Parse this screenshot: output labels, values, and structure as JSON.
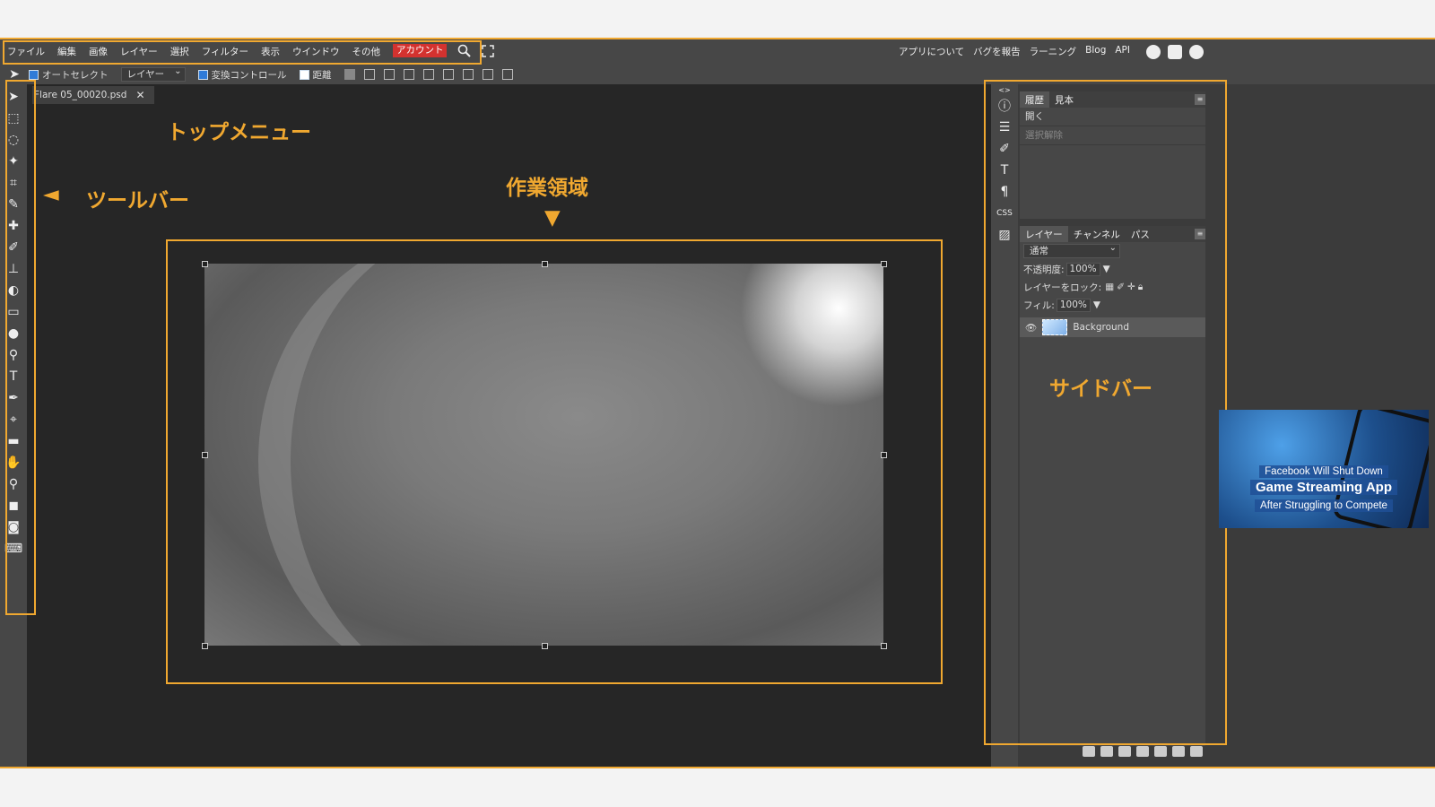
{
  "menu": {
    "items": [
      "ファイル",
      "編集",
      "画像",
      "レイヤー",
      "選択",
      "フィルター",
      "表示",
      "ウインドウ",
      "その他"
    ],
    "account": "アカウント",
    "right_items": [
      "アプリについて",
      "バグを報告",
      "ラーニング",
      "Blog",
      "API"
    ]
  },
  "options": {
    "autoselect_label": "オートセレクト",
    "autoselect_value": "レイヤー",
    "transform_label": "変換コントロール",
    "distance_label": "距離"
  },
  "document": {
    "tab_name": "Flare 05_00020.psd"
  },
  "history_panel": {
    "tabs": [
      "履歴",
      "見本"
    ],
    "rows": [
      "開く",
      "選択解除"
    ]
  },
  "layers_panel": {
    "tabs": [
      "レイヤー",
      "チャンネル",
      "パス"
    ],
    "blend_mode": "通常",
    "opacity_label": "不透明度:",
    "opacity_value": "100%",
    "lock_label": "レイヤーをロック:",
    "fill_label": "フィル:",
    "fill_value": "100%",
    "layer_name": "Background"
  },
  "annotations": {
    "top_menu": "トップメニュー",
    "toolbar": "ツールバー",
    "toolbar_arrow": "◄",
    "workspace": "作業領域",
    "workspace_arrow": "▼",
    "sidebar": "サイドバー"
  },
  "ad": {
    "line1": "Facebook Will Shut Down",
    "line2": "Game Streaming App",
    "line3": "After Struggling to Compete"
  },
  "colors": {
    "accent": "#f0a830",
    "account_bg": "#d4322f",
    "panel_bg": "#474747",
    "workspace_bg": "#262626"
  }
}
